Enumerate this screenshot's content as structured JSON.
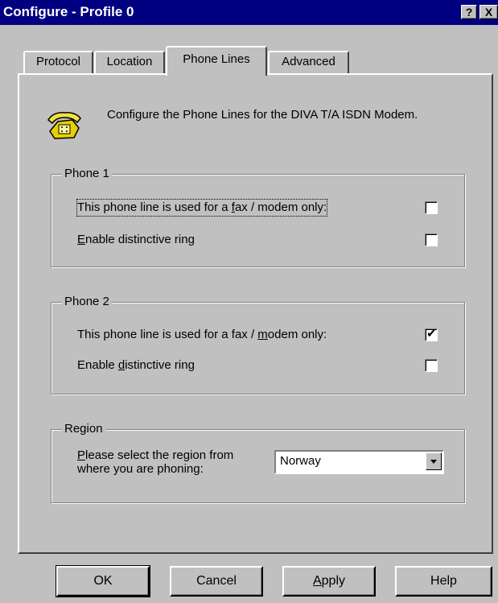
{
  "window": {
    "title": "Configure - Profile 0",
    "help_glyph": "?",
    "close_glyph": "X"
  },
  "tabs": [
    {
      "label": "Protocol",
      "active": false
    },
    {
      "label": "Location",
      "active": false
    },
    {
      "label": "Phone Lines",
      "active": true
    },
    {
      "label": "Advanced",
      "active": false
    }
  ],
  "intro": {
    "icon": "telephone-icon",
    "text": "Configure the Phone Lines for the DIVA T/A ISDN Modem."
  },
  "phone1": {
    "title": "Phone 1",
    "fax_only": {
      "pre": "This phone line is used for a ",
      "mnemonic": "f",
      "post": "ax / modem only:",
      "checked": false
    },
    "distinctive_ring": {
      "pre": "",
      "mnemonic": "E",
      "post": "nable distinctive ring",
      "checked": false
    }
  },
  "phone2": {
    "title": "Phone 2",
    "fax_only": {
      "pre": "This phone line is used for a fax / ",
      "mnemonic": "m",
      "post": "odem only:",
      "checked": true
    },
    "distinctive_ring": {
      "pre": "Enable ",
      "mnemonic": "d",
      "post": "istinctive ring",
      "checked": false
    }
  },
  "region": {
    "title": "Region",
    "prompt_line1": {
      "pre": "",
      "mnemonic": "P",
      "post": "lease select the region from"
    },
    "prompt_line2": "where you are phoning:",
    "selected": "Norway"
  },
  "buttons": {
    "ok": "OK",
    "cancel": "Cancel",
    "apply": {
      "pre": "",
      "mnemonic": "A",
      "post": "pply"
    },
    "help": "Help"
  },
  "colors": {
    "titlebar": "#000080",
    "face": "#c0c0c0",
    "field": "#ffffff"
  }
}
